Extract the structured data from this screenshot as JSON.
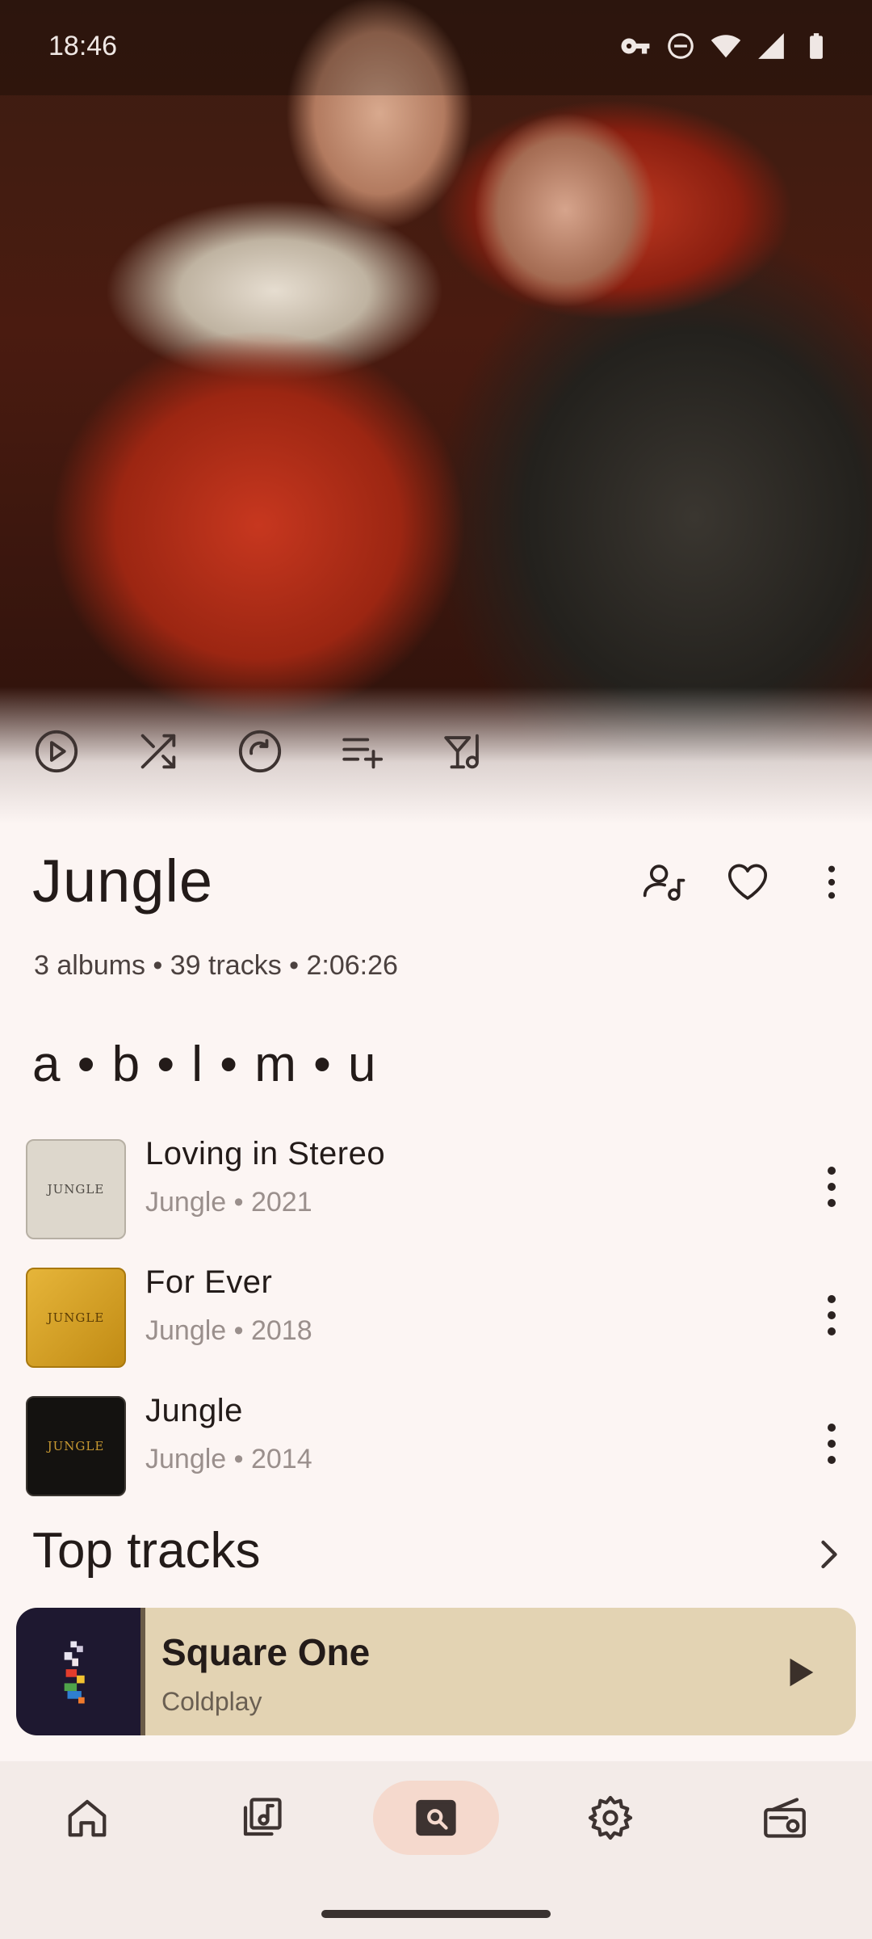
{
  "status_bar": {
    "time": "18:46",
    "icons": [
      "vpn-key-icon",
      "do-not-disturb-icon",
      "wifi-icon",
      "signal-icon",
      "battery-icon"
    ]
  },
  "artist": {
    "name": "Jungle",
    "meta": "3 albums • 39 tracks • 2:06:26"
  },
  "actions": [
    "play-icon",
    "shuffle-icon",
    "radio-icon",
    "add-to-queue-icon",
    "add-to-playlist-icon"
  ],
  "header_icons": [
    "artist-follow-icon",
    "heart-icon",
    "more-vert-icon"
  ],
  "albums_section": {
    "heading": "a • b • l • m • u",
    "items": [
      {
        "title": "Loving in Stereo",
        "subtitle": "Jungle • 2021",
        "cover_text": "JUNGLE",
        "cover_color": "#ddd7cc"
      },
      {
        "title": "For Ever",
        "subtitle": "Jungle • 2018",
        "cover_text": "JUNGLE",
        "cover_color": "#d9a12a"
      },
      {
        "title": "Jungle",
        "subtitle": "Jungle • 2014",
        "cover_text": "JUNGLE",
        "cover_color": "#141210"
      }
    ]
  },
  "top_tracks": {
    "heading": "Top tracks"
  },
  "mini_player": {
    "title": "Square One",
    "artist": "Coldplay",
    "background": "#e3d3b3"
  },
  "bottom_nav": {
    "items": [
      "home-icon",
      "library-icon",
      "search-icon",
      "settings-icon",
      "radio-device-icon"
    ],
    "active": "search-icon"
  }
}
